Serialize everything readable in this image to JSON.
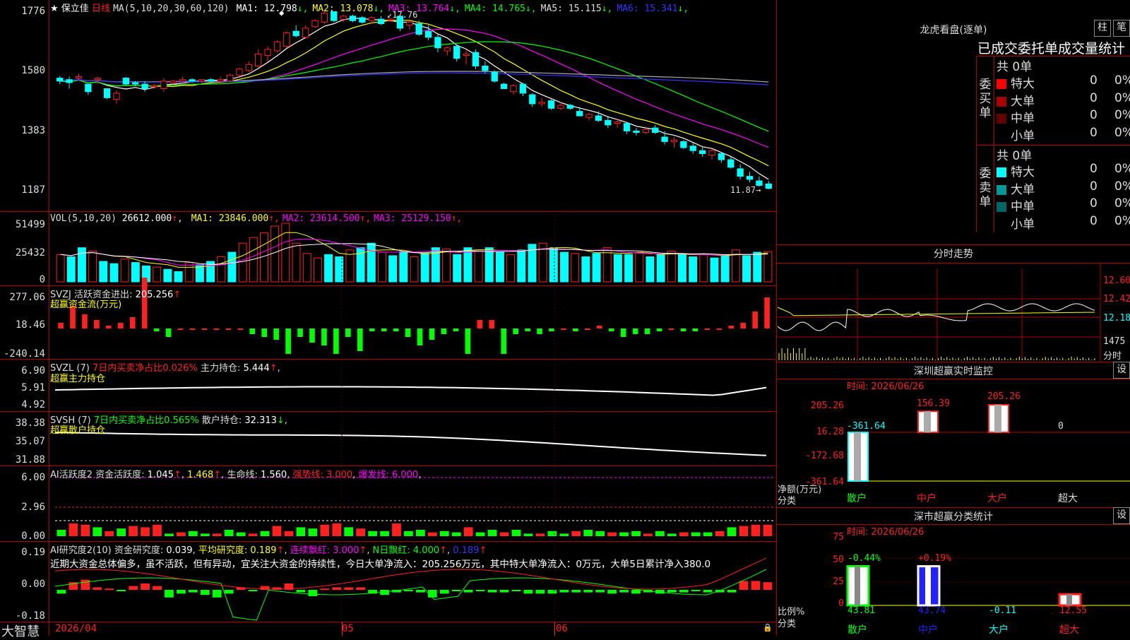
{
  "stock": {
    "title": "保立佳",
    "period": "日线",
    "fav_icon": "star-icon"
  },
  "main": {
    "ma_title": "MA(5,10,20,30,60,120)",
    "ma_items": [
      {
        "label": "MA1:",
        "value": "12.798",
        "arrow": "↓",
        "color": "#ffffff"
      },
      {
        "label": "MA2:",
        "value": "13.078",
        "arrow": "↓",
        "color": "#ffff00"
      },
      {
        "label": "MA3:",
        "value": "13.764",
        "arrow": "↓",
        "color": "#ff00ff"
      },
      {
        "label": "MA4:",
        "value": "14.765",
        "arrow": "↓",
        "color": "#00ff00"
      },
      {
        "label": "MA5:",
        "value": "15.115",
        "arrow": "↓",
        "color": "#dddddd"
      },
      {
        "label": "MA6:",
        "value": "15.341",
        "arrow": "↓",
        "color": "#3333ff"
      }
    ],
    "y_labels": [
      "1776",
      "1580",
      "1383",
      "1187"
    ],
    "high_label": "17.76",
    "low_label": "11.87"
  },
  "vol": {
    "title": "VOL(5,10,20)",
    "value": "26612.000",
    "items": [
      {
        "label": "MA1:",
        "value": "23846.000",
        "color": "#ffff00"
      },
      {
        "label": "MA2:",
        "value": "23614.500",
        "color": "#ff00ff"
      },
      {
        "label": "MA3:",
        "value": "25129.150",
        "color": "#ff00ff"
      }
    ],
    "y_labels": [
      "51499",
      "25432",
      "0"
    ]
  },
  "svzj": {
    "title": "SVZJ",
    "label": "活跃资金进出:",
    "value": "205.256",
    "sub": "超赢资金流(万元)",
    "y_labels": [
      "277.06",
      "18.46",
      "-240.14"
    ]
  },
  "svzl": {
    "title": "SVZL (7)",
    "sub_label": "7日内买卖净占比0.026%",
    "label": "主力持仓:",
    "value": "5.444",
    "sub": "超赢主力持仓",
    "y_labels": [
      "6.90",
      "5.91",
      "4.92"
    ]
  },
  "svsh": {
    "title": "SVSH (7)",
    "sub_label": "7日内买卖净占比0.565%",
    "label": "散户持仓:",
    "value": "32.313",
    "sub": "超赢散户持仓",
    "y_labels": [
      "38.38",
      "35.07",
      "31.88"
    ]
  },
  "ai1": {
    "title": "AI活跃度2",
    "label": "资金活跃度:",
    "v1": "1.045",
    "v2": "1.468",
    "life_label": "生命线:",
    "life": "1.560",
    "strong": "强势线: 3.000",
    "burst": "爆发线: 6.000",
    "y_labels": [
      "6.00",
      "2.96",
      "0.00"
    ]
  },
  "ai2": {
    "title": "AI研究度2(10)",
    "label": "资金研究度:",
    "v1": "0.039",
    "avg": "平均研究度: 0.189",
    "cont": "连续飘红: 3.000",
    "nday": "N日飘红: 4.000",
    "last": "0.189",
    "comment": "近期大资金总体偏多，虽不活跃，但有异动，宜关注大资金的持续性，今日大单净流入：205.256万元，其中特大单净流入：0万元，大单5日累计净入380.0",
    "y_labels": [
      "0.19",
      "0.00",
      "-0.18"
    ]
  },
  "xaxis": {
    "labels": [
      "2026/04",
      "05",
      "06"
    ]
  },
  "brand": "大智慧",
  "lhb": {
    "title": "龙虎看盘(逐单)",
    "btn_col": "柱",
    "btn_bi": "笔",
    "subtitle": "已成交委托单成交量统计",
    "buy_side": "委买单",
    "sell_side": "委卖单",
    "buy_total": "共 0单",
    "sell_total": "共 0单",
    "buy_rows": [
      {
        "name": "特大",
        "count": "0",
        "pct": "0%",
        "color": "#ff0000"
      },
      {
        "name": "大单",
        "count": "0",
        "pct": "0%",
        "color": "#aa0000"
      },
      {
        "name": "中单",
        "count": "0",
        "pct": "0%",
        "color": "#660000"
      },
      {
        "name": "小单",
        "count": "0",
        "pct": "0%",
        "color": ""
      }
    ],
    "sell_rows": [
      {
        "name": "特大",
        "count": "0",
        "pct": "0%",
        "color": "#00ffff"
      },
      {
        "name": "大单",
        "count": "0",
        "pct": "0%",
        "color": "#009999"
      },
      {
        "name": "中单",
        "count": "0",
        "pct": "0%",
        "color": "#006666"
      },
      {
        "name": "小单",
        "count": "0",
        "pct": "0%",
        "color": ""
      }
    ]
  },
  "fenshi": {
    "title": "分时走势",
    "y_labels": [
      "12.60",
      "12.42",
      "12.18",
      "1475",
      "分时"
    ]
  },
  "monitor": {
    "title": "深圳超赢实时监控",
    "btn": "设",
    "time": "时间: 2026/06/26",
    "y_labels": [
      "205.26",
      "16.28",
      "-172.68",
      "-361.64"
    ],
    "bar_values": [
      "-361.64",
      "156.39",
      "205.26",
      "0"
    ],
    "cats": [
      "散户",
      "中户",
      "大户",
      "超大"
    ],
    "axis_label": "净额(万元)",
    "axis_label2": "分类"
  },
  "classify": {
    "title": "深市超赢分类统计",
    "btn": "设",
    "time": "时间: 2026/06/26",
    "y_labels": [
      "75",
      "50",
      "25",
      "0"
    ],
    "top_values": [
      "-0.44%",
      "+0.19%"
    ],
    "bottom_values": [
      "43.81",
      "43.74",
      "-0.11",
      "12.55"
    ],
    "cats": [
      "散户",
      "中户",
      "大户",
      "超大"
    ],
    "axis_label": "比例%",
    "axis_label2": "分类"
  },
  "colors": {
    "up": "#ff2020",
    "down": "#00ffff",
    "grid": "#b00000",
    "yellow": "#ffff00",
    "magenta": "#ff00ff",
    "green": "#00ff00",
    "white": "#ffffff",
    "blue": "#3333ff"
  },
  "chart_data": [
    {
      "type": "candlestick",
      "title": "保立佳 日线",
      "x": [
        "2026/04",
        "05",
        "06"
      ],
      "ohlc": [
        [
          15.55,
          15.62,
          15.35,
          15.45
        ],
        [
          15.5,
          15.6,
          15.2,
          15.4
        ],
        [
          15.55,
          15.7,
          15.5,
          15.6
        ],
        [
          15.35,
          15.35,
          15.0,
          15.1
        ],
        [
          15.5,
          15.6,
          15.35,
          15.55
        ],
        [
          15.2,
          15.2,
          14.85,
          14.9
        ],
        [
          14.85,
          15.15,
          14.7,
          15.05
        ],
        [
          15.55,
          15.6,
          15.3,
          15.35
        ],
        [
          15.4,
          15.45,
          15.3,
          15.35
        ],
        [
          15.35,
          15.45,
          15.1,
          15.2
        ],
        [
          15.3,
          15.35,
          15.2,
          15.3
        ],
        [
          15.2,
          15.55,
          15.1,
          15.45
        ],
        [
          15.4,
          15.5,
          15.35,
          15.45
        ],
        [
          15.45,
          15.6,
          15.35,
          15.5
        ],
        [
          15.5,
          15.55,
          15.4,
          15.45
        ],
        [
          15.45,
          15.5,
          15.4,
          15.5
        ],
        [
          15.5,
          15.55,
          15.4,
          15.45
        ],
        [
          15.45,
          15.6,
          15.4,
          15.5
        ],
        [
          15.45,
          15.7,
          15.4,
          15.65
        ],
        [
          15.65,
          15.9,
          15.6,
          15.85
        ],
        [
          15.8,
          16.1,
          15.75,
          16.0
        ],
        [
          15.95,
          16.5,
          15.9,
          16.35
        ],
        [
          16.3,
          16.6,
          16.1,
          16.5
        ],
        [
          16.45,
          16.8,
          16.4,
          16.75
        ],
        [
          16.6,
          17.1,
          16.55,
          17.05
        ],
        [
          17.1,
          17.3,
          16.9,
          16.95
        ],
        [
          16.9,
          17.3,
          16.85,
          17.2
        ],
        [
          17.25,
          17.5,
          17.2,
          17.45
        ],
        [
          17.4,
          17.8,
          17.35,
          17.7
        ],
        [
          17.75,
          17.76,
          17.4,
          17.45
        ],
        [
          17.5,
          17.65,
          17.4,
          17.6
        ],
        [
          17.6,
          17.65,
          17.4,
          17.45
        ],
        [
          17.55,
          17.6,
          17.35,
          17.4
        ],
        [
          17.45,
          17.6,
          17.35,
          17.55
        ],
        [
          17.5,
          17.6,
          17.3,
          17.35
        ],
        [
          17.5,
          17.55,
          17.4,
          17.5
        ],
        [
          17.6,
          17.65,
          17.1,
          17.2
        ],
        [
          17.3,
          17.45,
          17.15,
          17.4
        ],
        [
          17.35,
          17.45,
          16.95,
          17.0
        ],
        [
          17.1,
          17.3,
          16.8,
          16.9
        ],
        [
          16.9,
          17.0,
          16.4,
          16.55
        ],
        [
          16.45,
          16.6,
          16.3,
          16.55
        ],
        [
          16.6,
          16.65,
          16.1,
          16.2
        ],
        [
          16.3,
          16.5,
          16.0,
          16.35
        ],
        [
          16.4,
          16.5,
          15.85,
          15.95
        ],
        [
          15.95,
          16.1,
          15.7,
          15.8
        ],
        [
          15.75,
          15.8,
          15.4,
          15.45
        ],
        [
          15.35,
          15.4,
          15.2,
          15.2
        ],
        [
          15.1,
          15.35,
          15.0,
          15.3
        ],
        [
          15.35,
          15.4,
          14.95,
          15.05
        ],
        [
          15.0,
          15.05,
          14.6,
          14.7
        ],
        [
          14.7,
          14.9,
          14.6,
          14.75
        ],
        [
          14.8,
          14.85,
          14.5,
          14.55
        ],
        [
          14.55,
          14.75,
          14.5,
          14.65
        ],
        [
          14.65,
          14.7,
          14.5,
          14.55
        ],
        [
          14.45,
          14.6,
          14.3,
          14.3
        ],
        [
          14.25,
          14.4,
          14.15,
          14.35
        ],
        [
          14.3,
          14.45,
          14.1,
          14.15
        ],
        [
          14.15,
          14.3,
          13.9,
          14.0
        ],
        [
          14.05,
          14.2,
          13.9,
          14.1
        ],
        [
          14.05,
          14.1,
          13.7,
          13.8
        ],
        [
          13.8,
          13.9,
          13.65,
          13.75
        ],
        [
          13.75,
          13.95,
          13.7,
          13.85
        ],
        [
          13.9,
          14.0,
          13.7,
          13.75
        ],
        [
          13.6,
          13.8,
          13.35,
          13.45
        ],
        [
          13.45,
          13.6,
          13.25,
          13.5
        ],
        [
          13.45,
          13.5,
          13.2,
          13.25
        ],
        [
          13.3,
          13.4,
          13.05,
          13.15
        ],
        [
          13.15,
          13.3,
          12.95,
          13.05
        ],
        [
          13.0,
          13.2,
          12.85,
          13.15
        ],
        [
          13.05,
          13.1,
          12.75,
          12.85
        ],
        [
          12.85,
          12.95,
          12.55,
          12.6
        ],
        [
          12.55,
          12.7,
          12.2,
          12.3
        ],
        [
          12.3,
          12.45,
          12.1,
          12.2
        ],
        [
          12.15,
          12.3,
          11.95,
          12.0
        ],
        [
          12.05,
          12.15,
          11.87,
          11.9
        ]
      ],
      "ylim": [
        11.87,
        17.76
      ]
    },
    {
      "type": "bar",
      "title": "VOL(5,10,20)",
      "values": [
        24000,
        22000,
        30000,
        27000,
        18000,
        16000,
        20000,
        17000,
        14000,
        13000,
        11000,
        9000,
        17000,
        15000,
        18000,
        22000,
        26000,
        34000,
        39000,
        43000,
        49000,
        51499,
        34000,
        25000,
        21000,
        24000,
        22000,
        28000,
        30000,
        34000,
        26000,
        23000,
        26000,
        22000,
        25000,
        30000,
        29000,
        24000,
        30000,
        28000,
        30000,
        26000,
        24000,
        28000,
        33000,
        34000,
        30000,
        26000,
        25000,
        22000,
        25000,
        30000,
        24000,
        24000,
        26000,
        22000,
        24000,
        27000,
        24000,
        22000,
        24000,
        21000,
        24000,
        28000,
        23000,
        26000,
        26612
      ],
      "ylim": [
        0,
        51499
      ]
    },
    {
      "type": "bar",
      "title": "SVZJ 活跃资金进出",
      "values": [
        205.256
      ],
      "ylim": [
        -240.14,
        277.06
      ]
    },
    {
      "type": "line",
      "title": "SVZL 主力持仓",
      "values": [
        5.444
      ],
      "ylim": [
        4.92,
        6.9
      ]
    },
    {
      "type": "line",
      "title": "SVSH 散户持仓",
      "values": [
        32.313
      ],
      "ylim": [
        31.88,
        38.38
      ]
    },
    {
      "type": "bar",
      "title": "深圳超赢实时监控",
      "categories": [
        "散户",
        "中户",
        "大户",
        "超大"
      ],
      "values": [
        -361.64,
        156.39,
        205.26,
        0
      ],
      "ylim": [
        -361.64,
        205.26
      ]
    },
    {
      "type": "bar",
      "title": "深市超赢分类统计",
      "categories": [
        "散户",
        "中户",
        "大户",
        "超大"
      ],
      "values": [
        43.81,
        43.74,
        -0.11,
        12.55
      ],
      "ylim": [
        0,
        75
      ]
    }
  ]
}
